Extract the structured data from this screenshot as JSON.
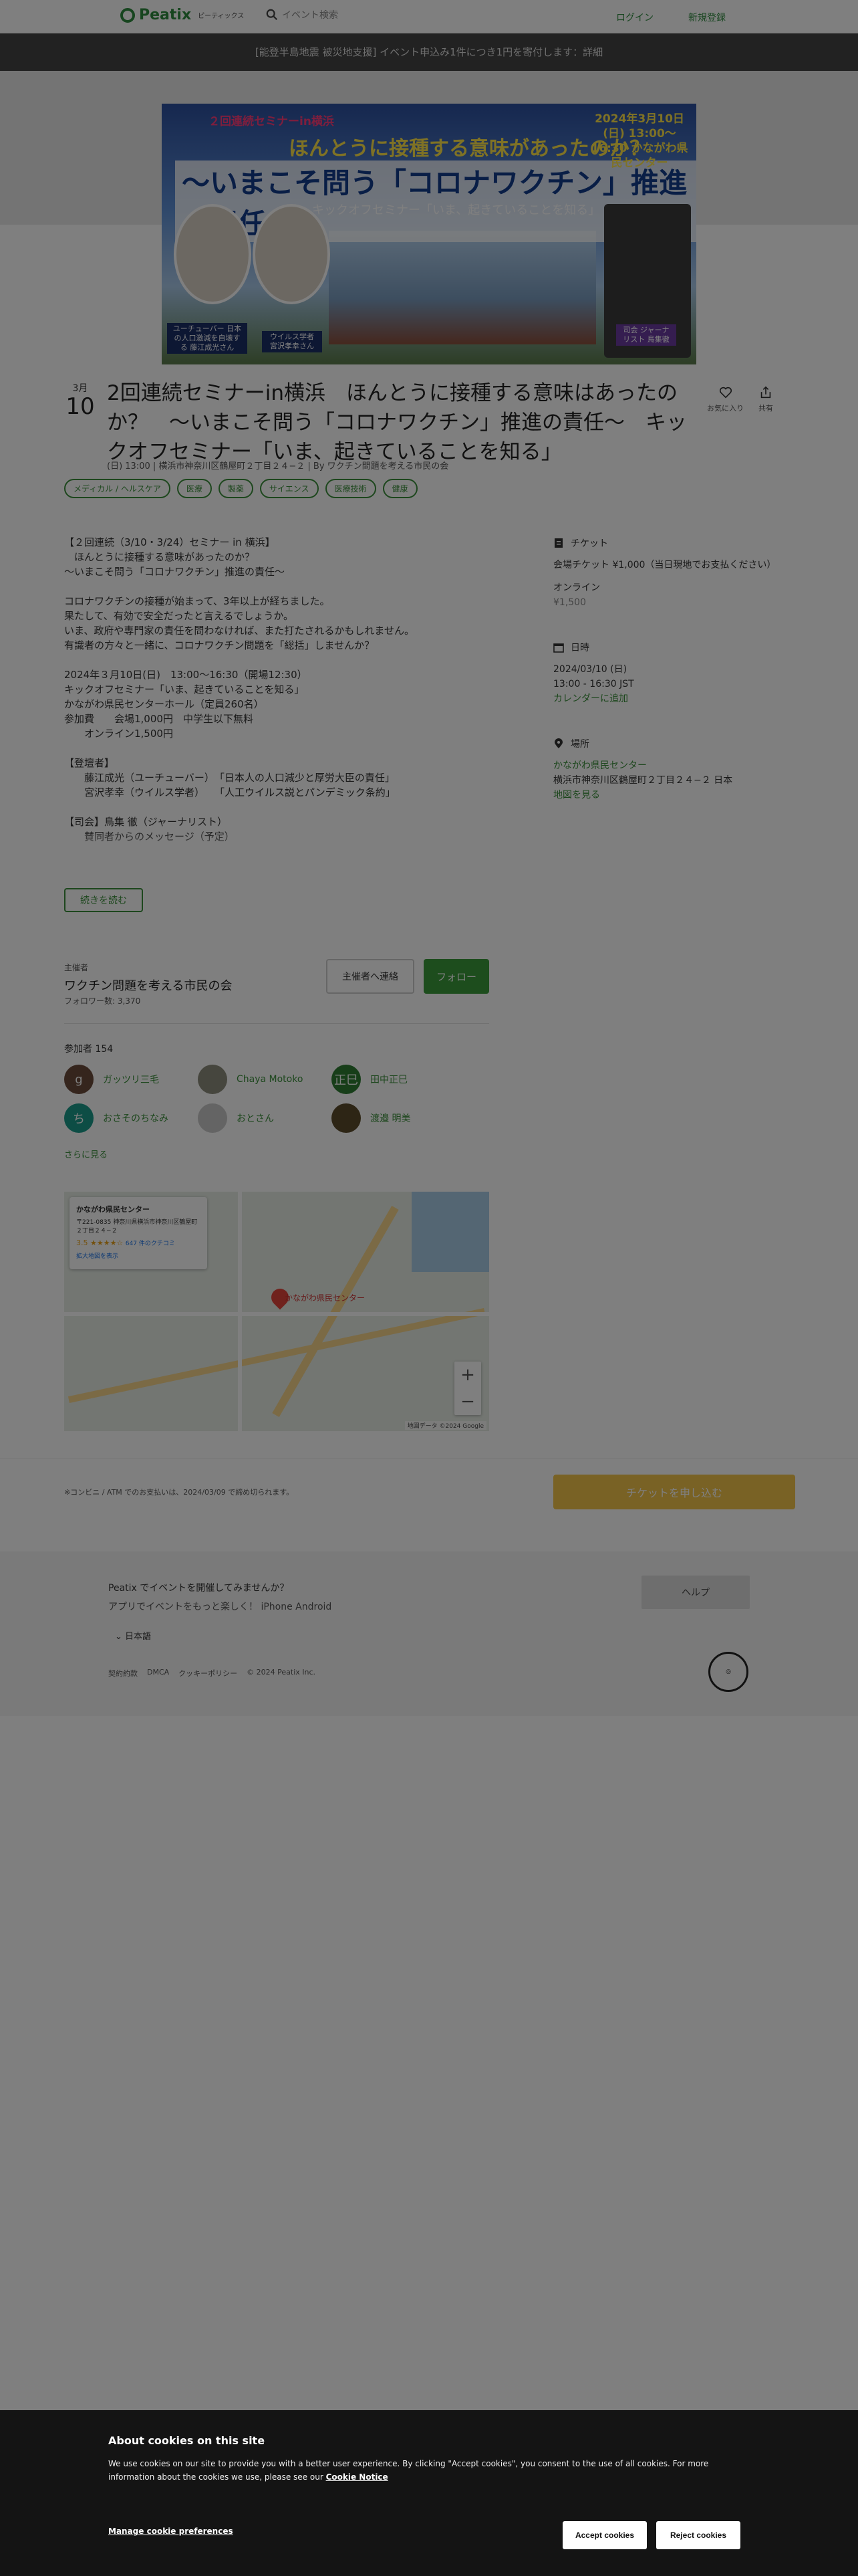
{
  "header": {
    "logo_text": "Peatix",
    "logo_sub": "ピーティックス",
    "search_placeholder": "イベント検索",
    "login_label": "ログイン",
    "signup_label": "新規登録"
  },
  "announcement": "[能登半島地震 被災地支援] イベント申込み1件につき1円を寄付します：詳細",
  "banner": {
    "series": "２回連続セミナーin横浜",
    "question": "ほんとうに接種する意味があったのか？",
    "main": "〜いまこそ問う「コロナワクチン」推進の責任〜",
    "sub": "キックオフセミナー「いま、起きていることを知る」",
    "date": "2024年3月10日(日) 13:00〜16:30 かながわ県民センター",
    "caption1": "ユーチューバー 日本の人口激減を自壊する 藤江成光さん",
    "caption2": "ウイルス学者 宮沢孝幸さん",
    "caption3": "司会 ジャーナリスト 鳥集徹"
  },
  "event": {
    "month": "3月",
    "day": "10",
    "title": "2回連続セミナーin横浜　ほんとうに接種する意味はあったのか？　〜いまこそ問う「コロナワクチン」推進の責任〜　キックオフセミナー「いま、起きていることを知る」",
    "meta": "(日) 13:00 | 横浜市神奈川区鶴屋町２丁目２４−２ | By ワクチン問題を考える市民の会",
    "favorite_label": "お気に入り",
    "share_label": "共有",
    "tags": [
      "メディカル / ヘルスケア",
      "医療",
      "製薬",
      "サイエンス",
      "医療技術",
      "健康"
    ]
  },
  "description": "【２回連続（3/10・3/24）セミナー in 横浜】\n　ほんとうに接種する意味があったのか？\n〜いまこそ問う「コロナワクチン」推進の責任〜\n\nコロナワクチンの接種が始まって、3年以上が経ちました。\n果たして、有効で安全だったと言えるでしょうか。\nいま、政府や専門家の責任を問わなければ、また打たされるかもしれません。\n有識者の方々と一緒に、コロナワクチン問題を「総括」しませんか？\n\n2024年３月10日(日)　13:00〜16:30（開場12:30）\nキックオフセミナー「いま、起きていることを知る」\nかながわ県民センターホール（定員260名）\n参加費　　会場1,000円　中学生以下無料\n　　オンライン1,500円\n\n【登壇者】\n　　藤江成光（ユーチューバー）　「日本人の人口減少と厚労大臣の責任」\n　　宮沢孝幸（ウイルス学者）　　「人工ウイルス説とパンデミック条約」\n\n【司会】鳥集 徹（ジャーナリスト）\n　　賛同者からのメッセージ（予定）",
  "read_more_label": "続きを読む",
  "side": {
    "ticket_head": "チケット",
    "ticket_venue": "会場チケット ¥1,000（当日現地でお支払ください）",
    "ticket_online_label": "オンライン",
    "ticket_online_price": "¥1,500",
    "date_head": "日時",
    "date_line1": "2024/03/10 (日)",
    "date_line2": "13:00 - 16:30 JST",
    "calendar_label": "カレンダーに追加",
    "place_head": "場所",
    "place_name": "かながわ県民センター",
    "place_address": "横浜市神奈川区鶴屋町２丁目２４−２ 日本",
    "map_link": "地図を見る"
  },
  "organizer": {
    "label": "主催者",
    "name": "ワクチン問題を考える市民の会",
    "followers": "フォロワー数: 3,370",
    "contact_label": "主催者へ連絡",
    "follow_label": "フォロー"
  },
  "attendees": {
    "label": "参加者 154",
    "items": [
      {
        "name": "ガッツリ三毛",
        "initial": "g",
        "color": "#6b4a3a"
      },
      {
        "name": "Chaya Motoko",
        "initial": "",
        "color": "#8c8c7c"
      },
      {
        "name": "田中正巳",
        "initial": "正巳",
        "color": "#2e7d32"
      },
      {
        "name": "おさそのちなみ",
        "initial": "ち",
        "color": "#1a9a8a"
      },
      {
        "name": "おとさん",
        "initial": "",
        "color": "#c8c8c8"
      },
      {
        "name": "渡邉 明美",
        "initial": "",
        "color": "#5a4a2a"
      }
    ],
    "see_more": "さらに見る"
  },
  "map": {
    "card_title": "かながわ県民センター",
    "card_address": "〒221-0835 神奈川県横浜市神奈川区鶴屋町２丁目２４−２",
    "rating": "3.5 ★★★★☆",
    "reviews": "647 件のクチコミ",
    "card_link": "拡大地図を表示",
    "label": "かながわ県民センター",
    "credit": "地図データ ©2024 Google"
  },
  "purchase": {
    "note": "※コンビニ / ATM でのお支払いは、2024/03/09 で締め切られます。",
    "buy_label": "チケットを申し込む"
  },
  "footer": {
    "line1": "Peatix でイベントを開催してみませんか？",
    "line2": "アプリでイベントをもっと楽しく！ iPhone Android",
    "help_label": "ヘルプ",
    "language": "日本語",
    "links": [
      "契約約款",
      "DMCA",
      "クッキーポリシー",
      "© 2024 Peatix Inc."
    ]
  },
  "cookie": {
    "title": "About cookies on this site",
    "body": "We use cookies on our site to provide you with a better user experience. By clicking \"Accept cookies\", you consent to the use of all cookies. For more information about the cookies we use, please see our",
    "notice_link": "Cookie Notice",
    "manage_label": "Manage cookie preferences",
    "accept_label": "Accept cookies",
    "reject_label": "Reject cookies"
  }
}
